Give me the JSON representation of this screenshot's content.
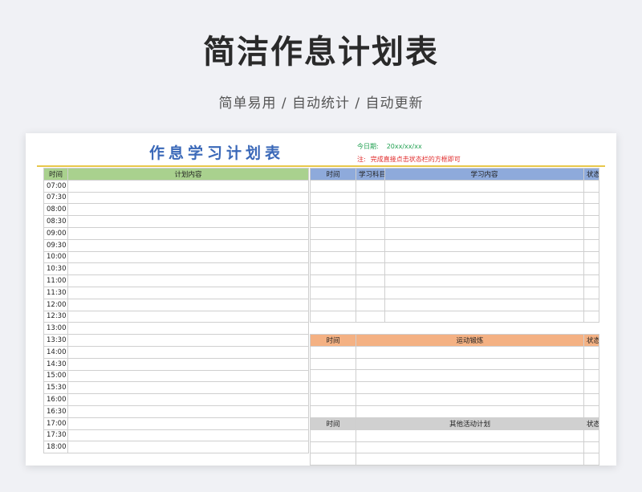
{
  "hero": {
    "title": "简洁作息计划表",
    "subtitle": "简单易用 / 自动统计 / 自动更新"
  },
  "sheet": {
    "title": "作息学习计划表",
    "today_label": "今日期:",
    "today_value": "20xx/xx/xx",
    "note_label": "注:",
    "note_text": "完成直接点击状态栏的方框即可"
  },
  "schedule": {
    "headers": [
      "时间",
      "计划内容"
    ],
    "times": [
      "07:00",
      "07:30",
      "08:00",
      "08:30",
      "09:00",
      "09:30",
      "10:00",
      "10:30",
      "11:00",
      "11:30",
      "12:00",
      "12:30",
      "13:00",
      "13:30",
      "14:00",
      "14:30",
      "15:00",
      "15:30",
      "16:00",
      "16:30",
      "17:00",
      "17:30",
      "18:00"
    ]
  },
  "study": {
    "headers": [
      "时间",
      "学习科目",
      "学习内容",
      "状态"
    ]
  },
  "exercise": {
    "headers": [
      "时间",
      "运动锻炼",
      "状态"
    ]
  },
  "other": {
    "headers": [
      "时间",
      "其他活动计划",
      "状态"
    ]
  },
  "colors": {
    "schedule_header": "#a9d18e",
    "study_header": "#8eaadb",
    "exercise_header": "#f4b183",
    "other_header": "#d0d0d0",
    "title_blue": "#3a68b8",
    "rule_gold": "#e8c74a"
  }
}
